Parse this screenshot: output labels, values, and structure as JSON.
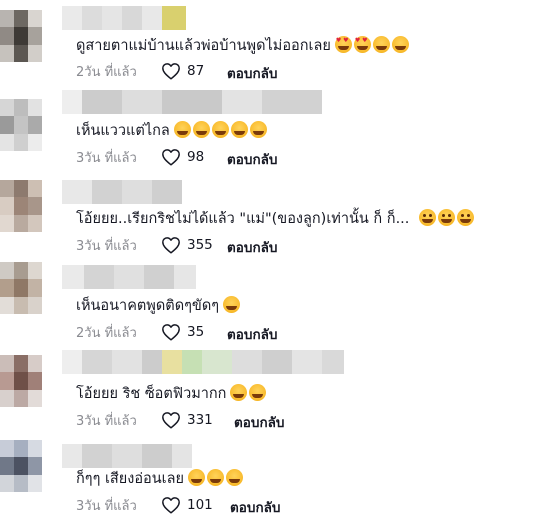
{
  "comments": [
    {
      "text": "ดูสายตาแม่บ้านแล้วพ่อบ้านพูดไม่ออกเลย",
      "emojis": [
        "heart-eyes",
        "heart-eyes",
        "joy",
        "joy"
      ],
      "time": "2วัน ที่แล้ว",
      "likes": "87",
      "reply": "ตอบกลับ"
    },
    {
      "text": "เห็นแววแต่ไกล",
      "emojis": [
        "joy",
        "joy",
        "joy",
        "joy",
        "joy"
      ],
      "time": "3วัน ที่แล้ว",
      "likes": "98",
      "reply": "ตอบกลับ"
    },
    {
      "text": "โอ้ยยย..เรียกริชไม่ได้แล้ว \"แม่\"(ของลูก)เท่านั้น ก็ ก็...",
      "emojis": [
        "grin",
        "grin",
        "grin"
      ],
      "time": "3วัน ที่แล้ว",
      "likes": "355",
      "reply": "ตอบกลับ"
    },
    {
      "text": "เห็นอนาคตพูดติดๆขัดๆ",
      "emojis": [
        "joy"
      ],
      "time": "2วัน ที่แล้ว",
      "likes": "35",
      "reply": "ตอบกลับ"
    },
    {
      "text": "โอ้ยยย ริช ซ็อตฟิวมากก",
      "emojis": [
        "joy",
        "joy"
      ],
      "time": "3วัน ที่แล้ว",
      "likes": "331",
      "reply": "ตอบกลับ"
    },
    {
      "text": "ก็ๆๆ เสียงอ่อนเลย",
      "emojis": [
        "joy",
        "joy",
        "joy"
      ],
      "time": "3วัน ที่แล้ว",
      "likes": "101",
      "reply": "ตอบกลับ"
    }
  ],
  "colors": {
    "text": "#161823",
    "muted": "#8a8b91",
    "heart_outline": "#161823"
  }
}
